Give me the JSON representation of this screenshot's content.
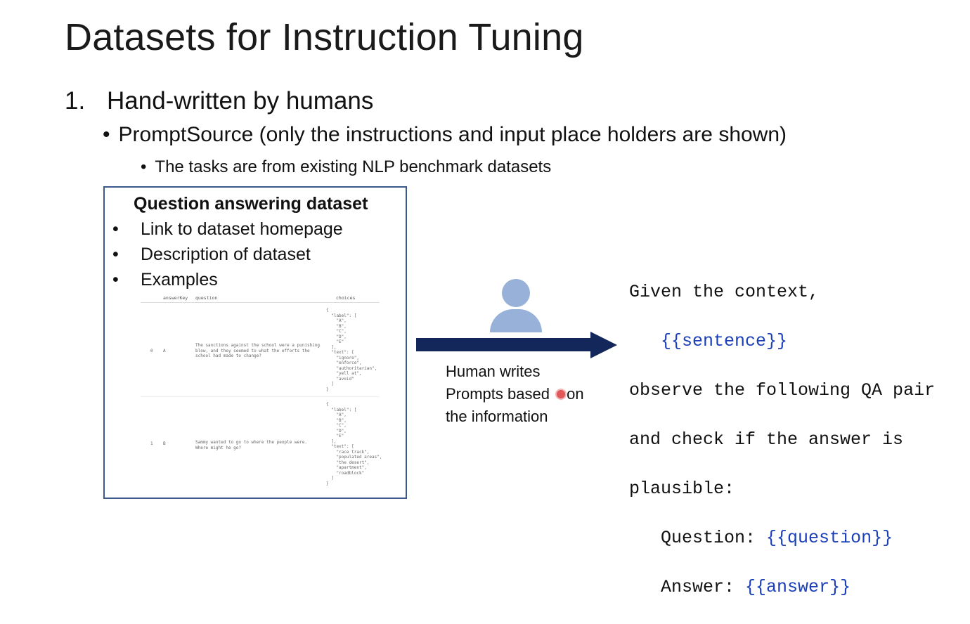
{
  "slide": {
    "title": "Datasets for Instruction Tuning",
    "level1": {
      "number": "1.",
      "text": "Hand-written by humans"
    },
    "level2": "PromptSource (only the instructions and input place holders are shown)",
    "level3": "The tasks are from existing NLP benchmark datasets",
    "bullet": "•"
  },
  "panel": {
    "title": "Question answering dataset",
    "items": [
      "Link to dataset homepage",
      "Description of dataset",
      "Examples"
    ],
    "table": {
      "headers": [
        "answerKey",
        "question",
        "choices"
      ],
      "rows": [
        {
          "index": "0",
          "answerKey": "A",
          "question": "The sanctions against the school were a punishing\nblow, and they seemed to what the efforts the\nschool had made to change?",
          "choices": "{\n  \"label\": [\n    \"A\",\n    \"B\",\n    \"C\",\n    \"D\",\n    \"E\"\n  ],\n  \"text\": [\n    \"ignore\",\n    \"enforce\",\n    \"authoritarian\",\n    \"yell at\",\n    \"avoid\"\n  ]\n}"
        },
        {
          "index": "1",
          "answerKey": "B",
          "question": "Sammy wanted to go to where the people were.\nWhere might he go?",
          "choices": "{\n  \"label\": [\n    \"A\",\n    \"B\",\n    \"C\",\n    \"D\",\n    \"E\"\n  ],\n  \"text\": [\n    \"race track\",\n    \"populated areas\",\n    \"the desert\",\n    \"apartment\",\n    \"roadblock\"\n  ]\n}"
        }
      ]
    }
  },
  "caption": {
    "line1": "Human writes",
    "line2_a": "Prompts based ",
    "line2_b": "on",
    "line3": "the information"
  },
  "prompt": {
    "line1": "Given the context,",
    "sentence": "{{sentence}}",
    "line3": "observe the following QA pair",
    "line4": "and check if the answer is",
    "line5": "plausible:",
    "q_label": "Question: ",
    "q_ph": "{{question}}",
    "a_label": "Answer: ",
    "a_ph": "{{answer}}"
  },
  "colors": {
    "placeholder": "#1a3fb8",
    "person": "#97b1d8",
    "arrow": "#13275a",
    "panel_border": "#3d5a8c"
  },
  "icons": {
    "person": "person-icon",
    "arrow": "right-arrow-icon"
  }
}
